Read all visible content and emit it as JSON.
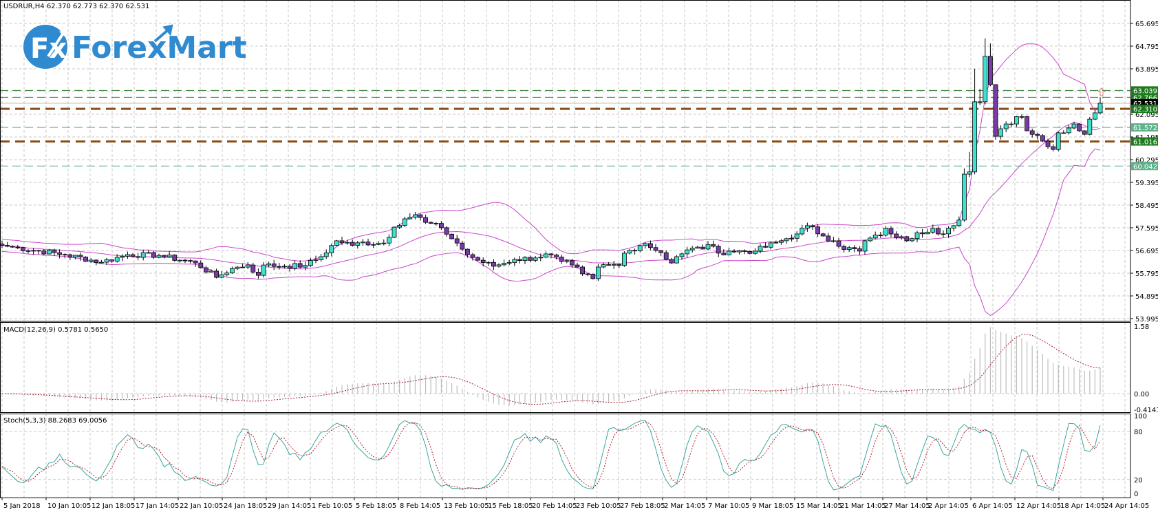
{
  "header": {
    "symbol_legend": "USDRUR,H4  62.370 62.773 62.370 62.531",
    "macd_legend": "MACD(12,26,9) 0.5781 0.5650",
    "stoch_legend": "Stoch(5,3,3) 88.2683 69.0056"
  },
  "logo": {
    "mark": "Fx",
    "text": "ForexMart"
  },
  "colors": {
    "bull": "#40e0d0",
    "bear": "#7a3aa8",
    "bollinger": "#c846c8",
    "macd_bars": "#bdbdbd",
    "macd_signal": "#a3202c",
    "stoch_main": "#3aa6a0",
    "stoch_signal": "#b0202a",
    "level_dark": "#1e7a1e",
    "level_light": "#5fb28c",
    "level_brown": "#8a4b16",
    "current": "#000000"
  },
  "chart_data": {
    "type": "candlestick",
    "title": "USDRUR,H4",
    "ohlc_legend": {
      "open": 62.37,
      "high": 62.773,
      "low": 62.37,
      "close": 62.531
    },
    "bar_count": 211,
    "ylim": [
      53.995,
      65.695
    ],
    "price_ticks": [
      "65.695",
      "64.795",
      "63.895",
      "62.095",
      "61.195",
      "60.295",
      "59.395",
      "58.495",
      "57.595",
      "56.695",
      "55.795",
      "54.895",
      "53.995"
    ],
    "close_keypoints": [
      [
        0,
        56.9
      ],
      [
        1,
        56.86
      ],
      [
        12,
        56.53
      ],
      [
        19,
        56.23
      ],
      [
        24,
        56.53
      ],
      [
        30,
        56.5
      ],
      [
        37,
        56.2
      ],
      [
        41,
        55.63
      ],
      [
        44,
        55.98
      ],
      [
        47,
        56.12
      ],
      [
        49,
        55.71
      ],
      [
        50,
        56.12
      ],
      [
        54,
        56.07
      ],
      [
        58,
        56.1
      ],
      [
        61,
        56.45
      ],
      [
        64,
        57.08
      ],
      [
        67,
        56.9
      ],
      [
        68,
        57.0
      ],
      [
        73,
        56.99
      ],
      [
        75,
        57.62
      ],
      [
        77,
        57.95
      ],
      [
        79,
        58.11
      ],
      [
        81,
        57.81
      ],
      [
        84,
        57.6
      ],
      [
        86,
        57.16
      ],
      [
        87,
        56.99
      ],
      [
        89,
        56.53
      ],
      [
        91,
        56.31
      ],
      [
        94,
        56.07
      ],
      [
        98,
        56.34
      ],
      [
        102,
        56.4
      ],
      [
        104,
        56.56
      ],
      [
        107,
        56.26
      ],
      [
        109,
        56.12
      ],
      [
        111,
        55.77
      ],
      [
        113,
        55.58
      ],
      [
        114,
        56.04
      ],
      [
        116,
        56.12
      ],
      [
        118,
        56.1
      ],
      [
        119,
        56.59
      ],
      [
        122,
        56.89
      ],
      [
        123,
        56.97
      ],
      [
        126,
        56.61
      ],
      [
        128,
        56.2
      ],
      [
        129,
        56.45
      ],
      [
        131,
        56.72
      ],
      [
        136,
        56.86
      ],
      [
        137,
        56.59
      ],
      [
        139,
        56.67
      ],
      [
        144,
        56.67
      ],
      [
        149,
        57.08
      ],
      [
        152,
        57.35
      ],
      [
        154,
        57.68
      ],
      [
        157,
        57.27
      ],
      [
        159,
        57.08
      ],
      [
        160,
        56.86
      ],
      [
        164,
        56.67
      ],
      [
        165,
        57.08
      ],
      [
        168,
        57.3
      ],
      [
        169,
        57.57
      ],
      [
        170,
        57.35
      ],
      [
        173,
        57.08
      ],
      [
        175,
        57.4
      ],
      [
        178,
        57.57
      ],
      [
        179,
        57.35
      ],
      [
        182,
        57.68
      ],
      [
        183,
        57.9
      ],
      [
        184,
        59.72
      ],
      [
        185,
        59.81
      ],
      [
        186,
        62.59
      ],
      [
        187,
        62.59
      ],
      [
        188,
        64.39
      ],
      [
        189,
        63.27
      ],
      [
        190,
        61.22
      ],
      [
        191,
        61.52
      ],
      [
        192,
        61.71
      ],
      [
        193,
        61.71
      ],
      [
        194,
        62.0
      ],
      [
        195,
        62.0
      ],
      [
        196,
        61.44
      ],
      [
        197,
        61.3
      ],
      [
        198,
        61.25
      ],
      [
        199,
        61.03
      ],
      [
        200,
        60.81
      ],
      [
        201,
        60.7
      ],
      [
        202,
        61.36
      ],
      [
        203,
        61.36
      ],
      [
        204,
        61.55
      ],
      [
        205,
        61.71
      ],
      [
        206,
        61.44
      ],
      [
        207,
        61.3
      ],
      [
        208,
        61.9
      ],
      [
        209,
        62.15
      ],
      [
        210,
        62.531
      ]
    ],
    "high_overrides": [
      [
        184,
        59.95
      ],
      [
        185,
        60.6
      ],
      [
        186,
        63.9
      ],
      [
        187,
        63.1
      ],
      [
        188,
        65.1
      ],
      [
        189,
        64.9
      ],
      [
        190,
        62.5
      ],
      [
        210,
        62.773
      ]
    ],
    "indicators": {
      "bollinger": {
        "period": 20,
        "deviation": 2
      },
      "macd": {
        "fast": 12,
        "slow": 26,
        "signal": 9,
        "ylim": [
          -0.4141,
          1.58
        ],
        "ticks": [
          "1.58",
          "0.00",
          "-0.4141"
        ],
        "last_main": 0.5781,
        "last_signal": 0.565
      },
      "stochastic": {
        "k": 5,
        "d": 3,
        "slowing": 3,
        "ylim": [
          0,
          100
        ],
        "ticks": [
          "100",
          "80",
          "20",
          "0"
        ],
        "levels": [
          80,
          20
        ],
        "last_main": 88.2683,
        "last_signal": 69.0056
      }
    },
    "levels": [
      {
        "value": 63.039,
        "label": "63.039",
        "kind": "dark"
      },
      {
        "value": 62.766,
        "label": "62.766",
        "kind": "dark"
      },
      {
        "value": 62.531,
        "label": "62.531",
        "kind": "current"
      },
      {
        "value": 62.31,
        "label": "62.310",
        "kind": "brown"
      },
      {
        "value": 61.572,
        "label": "61.572",
        "kind": "light"
      },
      {
        "value": 61.016,
        "label": "61.016",
        "kind": "brown"
      },
      {
        "value": 60.042,
        "label": "60.042",
        "kind": "light"
      }
    ],
    "x_labels": [
      "5 Jan 2018",
      "10 Jan 10:05",
      "12 Jan 18:05",
      "17 Jan 14:05",
      "22 Jan 10:05",
      "24 Jan 18:05",
      "29 Jan 14:05",
      "1 Feb 10:05",
      "5 Feb 18:05",
      "8 Feb 14:05",
      "13 Feb 10:05",
      "15 Feb 18:05",
      "20 Feb 14:05",
      "23 Feb 10:05",
      "27 Feb 18:05",
      "2 Mar 14:05",
      "7 Mar 10:05",
      "9 Mar 18:05",
      "15 Mar 14:05",
      "21 Mar 14:05",
      "27 Mar 14:05",
      "2 Apr 14:05",
      "6 Apr 14:05",
      "12 Apr 14:05",
      "18 Apr 14:05",
      "24 Apr 14:05"
    ]
  }
}
